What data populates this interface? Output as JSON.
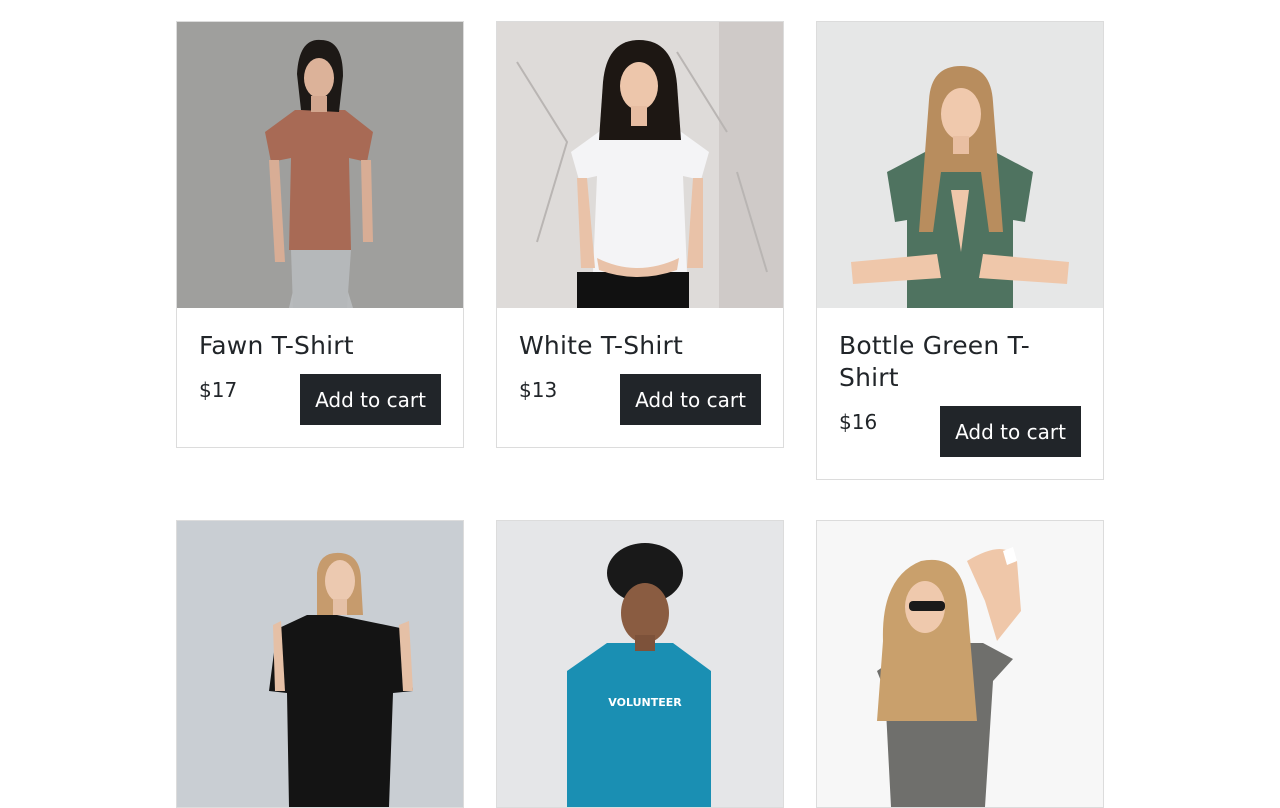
{
  "products": [
    {
      "name": "Fawn T-Shirt",
      "price": "$17",
      "button": "Add to cart",
      "image": "woman-fawn-tshirt-photo",
      "shirt_color": "#a86a55",
      "bg": "#9c9c9a"
    },
    {
      "name": "White T-Shirt",
      "price": "$13",
      "button": "Add to cart",
      "image": "woman-white-tshirt-photo",
      "shirt_color": "#f4f4f6",
      "bg": "#d8d6d6"
    },
    {
      "name": "Bottle Green T-Shirt",
      "price": "$16",
      "button": "Add to cart",
      "image": "woman-green-tshirt-photo",
      "shirt_color": "#4f7360",
      "bg": "#e6e7e7"
    },
    {
      "name": "",
      "price": "",
      "button": "",
      "image": "woman-black-tshirt-photo",
      "shirt_color": "#141414",
      "bg": "#c9ced3"
    },
    {
      "name": "",
      "price": "",
      "button": "",
      "image": "woman-blue-volunteer-tshirt-photo",
      "shirt_color": "#1a8fb3",
      "bg": "#e5e6e8",
      "shirt_text": "VOLUNTEER"
    },
    {
      "name": "",
      "price": "",
      "button": "",
      "image": "woman-grey-graphic-tshirt-photo",
      "shirt_color": "#6f6f6c",
      "bg": "#f7f7f7"
    }
  ]
}
